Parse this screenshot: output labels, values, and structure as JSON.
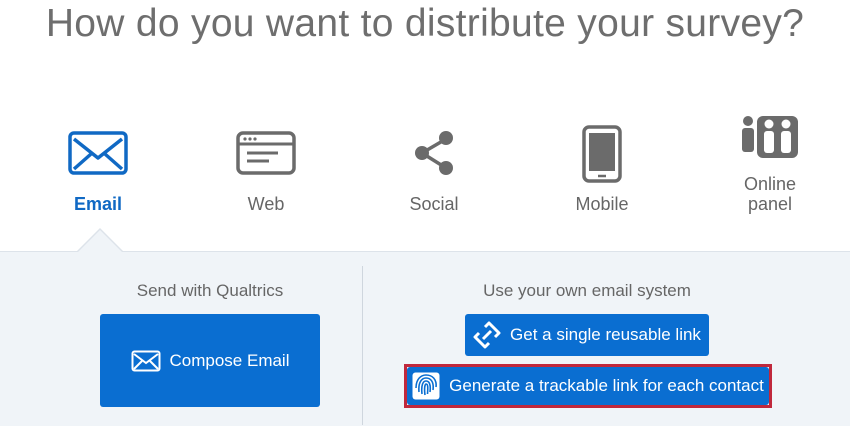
{
  "page": {
    "title": "How do you want to distribute your survey?"
  },
  "options": [
    {
      "label": "Email",
      "icon": "envelope-icon",
      "active": true
    },
    {
      "label": "Web",
      "icon": "browser-window-icon",
      "active": false
    },
    {
      "label": "Social",
      "icon": "share-icon",
      "active": false
    },
    {
      "label": "Mobile",
      "icon": "smartphone-icon",
      "active": false
    },
    {
      "label": "Online\npanel",
      "icon": "people-panel-icon",
      "active": false
    }
  ],
  "left_section": {
    "heading": "Send with Qualtrics",
    "compose_label": "Compose Email",
    "compose_icon": "envelope-icon"
  },
  "right_section": {
    "heading": "Use your own email system",
    "single_link_label": "Get a single reusable link",
    "single_link_icon": "link-icon",
    "trackable_label": "Generate a trackable link for each contact",
    "trackable_icon": "fingerprint-icon"
  },
  "colors": {
    "accent": "#0a6ed1",
    "active_label": "#1069c4",
    "icon_gray": "#6b6b6b",
    "panel_bg": "#f0f4f8",
    "highlight": "#c0283c"
  }
}
